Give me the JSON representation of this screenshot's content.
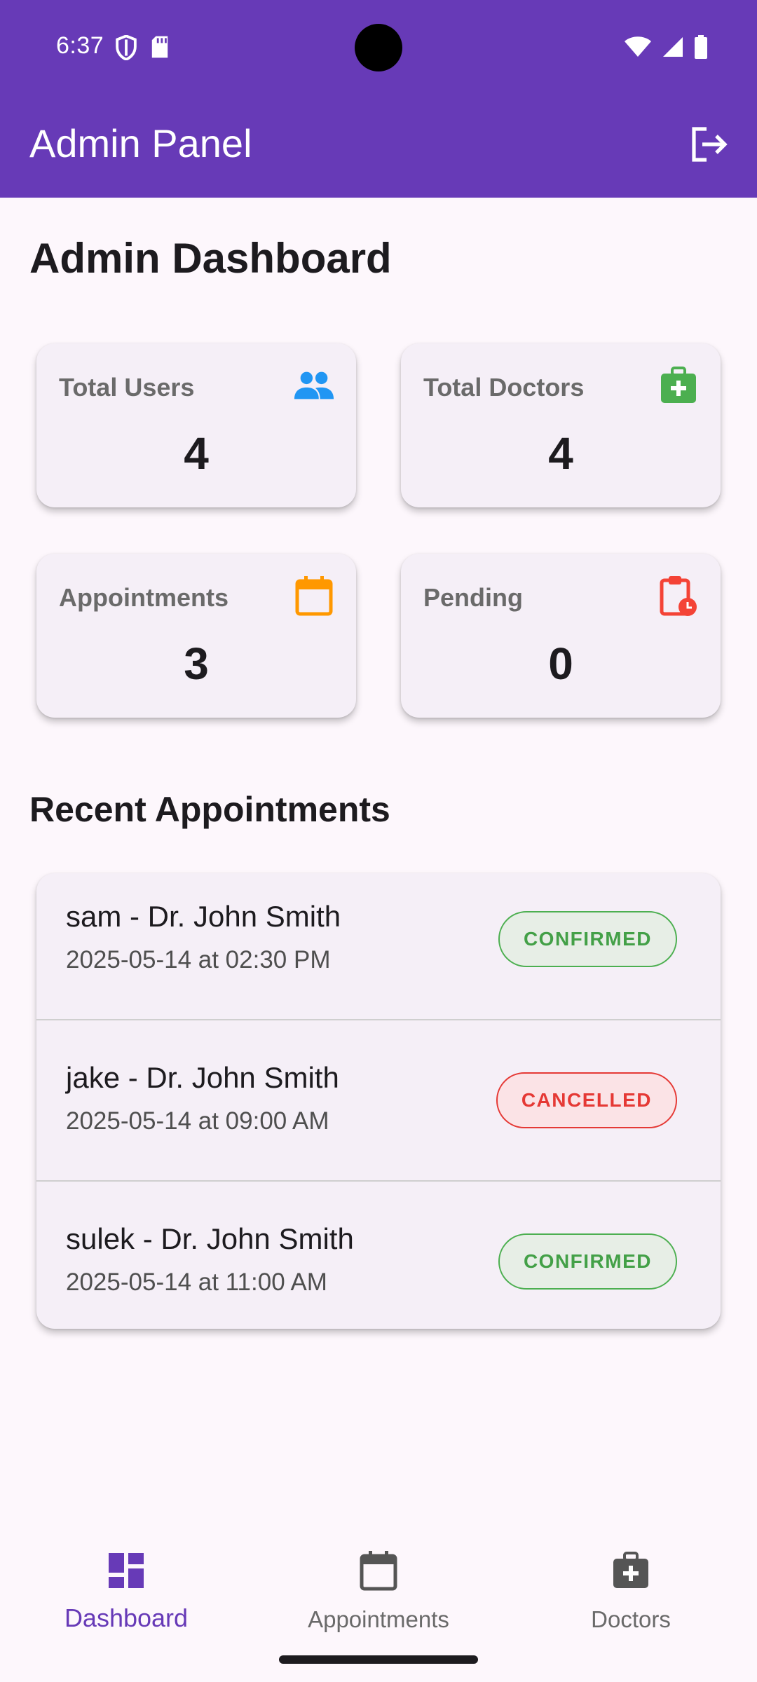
{
  "status_bar": {
    "time": "6:37"
  },
  "app_bar": {
    "title": "Admin Panel"
  },
  "page": {
    "title": "Admin Dashboard"
  },
  "stats": [
    {
      "label": "Total Users",
      "value": "4",
      "icon": "people-icon",
      "color": "#2196f3"
    },
    {
      "label": "Total Doctors",
      "value": "4",
      "icon": "medical-bag-icon",
      "color": "#4caf50"
    },
    {
      "label": "Appointments",
      "value": "3",
      "icon": "calendar-icon",
      "color": "#ff9800"
    },
    {
      "label": "Pending",
      "value": "0",
      "icon": "pending-clipboard-icon",
      "color": "#f44336"
    }
  ],
  "recent": {
    "title": "Recent Appointments",
    "items": [
      {
        "title": "sam - Dr. John Smith",
        "datetime": "2025-05-14 at 02:30 PM",
        "status": "CONFIRMED"
      },
      {
        "title": "jake - Dr. John Smith",
        "datetime": "2025-05-14 at 09:00 AM",
        "status": "CANCELLED"
      },
      {
        "title": "sulek - Dr. John Smith",
        "datetime": "2025-05-14 at 11:00 AM",
        "status": "CONFIRMED"
      }
    ]
  },
  "nav": [
    {
      "label": "Dashboard",
      "icon": "dashboard-icon",
      "active": true
    },
    {
      "label": "Appointments",
      "icon": "calendar-icon",
      "active": false
    },
    {
      "label": "Doctors",
      "icon": "medical-bag-icon",
      "active": false
    }
  ],
  "colors": {
    "primary": "#673ab7",
    "confirmed": "#4caf50",
    "cancelled": "#e53935"
  }
}
